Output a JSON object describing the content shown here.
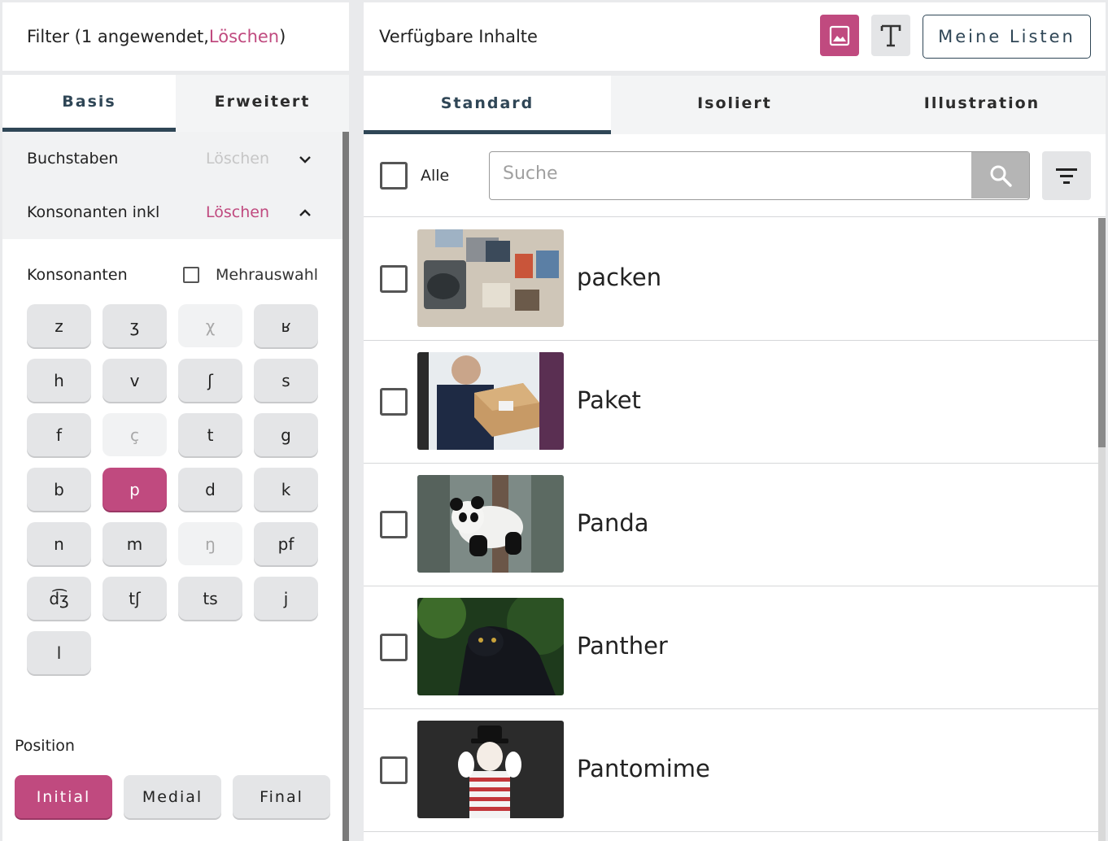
{
  "filter": {
    "prefix": "Filter (1 angewendet, ",
    "clear": "Löschen",
    "suffix": ")"
  },
  "left_tabs": [
    {
      "label": "Basis",
      "active": true
    },
    {
      "label": "Erweitert",
      "active": false
    }
  ],
  "accordions": [
    {
      "label": "Buchstaben",
      "clear": "Löschen",
      "clear_active": false,
      "expanded": false
    },
    {
      "label": "Konsonanten inkl",
      "clear": "Löschen",
      "clear_active": true,
      "expanded": true
    }
  ],
  "consonants": {
    "label": "Konsonanten",
    "multi_label": "Mehrauswahl",
    "multi_checked": false,
    "items": [
      {
        "label": "z",
        "state": "normal"
      },
      {
        "label": "ʒ",
        "state": "normal"
      },
      {
        "label": "χ",
        "state": "disabled"
      },
      {
        "label": "ʁ",
        "state": "normal"
      },
      {
        "label": "h",
        "state": "normal"
      },
      {
        "label": "v",
        "state": "normal"
      },
      {
        "label": "ʃ",
        "state": "normal"
      },
      {
        "label": "s",
        "state": "normal"
      },
      {
        "label": "f",
        "state": "normal"
      },
      {
        "label": "ç",
        "state": "disabled"
      },
      {
        "label": "t",
        "state": "normal"
      },
      {
        "label": "g",
        "state": "normal"
      },
      {
        "label": "b",
        "state": "normal"
      },
      {
        "label": "p",
        "state": "selected"
      },
      {
        "label": "d",
        "state": "normal"
      },
      {
        "label": "k",
        "state": "normal"
      },
      {
        "label": "n",
        "state": "normal"
      },
      {
        "label": "m",
        "state": "normal"
      },
      {
        "label": "ŋ",
        "state": "disabled"
      },
      {
        "label": "pf",
        "state": "normal"
      },
      {
        "label": "d͡ʒ",
        "state": "normal"
      },
      {
        "label": "tʃ",
        "state": "normal"
      },
      {
        "label": "ts",
        "state": "normal"
      },
      {
        "label": "j",
        "state": "normal"
      },
      {
        "label": "l",
        "state": "normal"
      }
    ]
  },
  "position": {
    "label": "Position",
    "options": [
      {
        "label": "Initial",
        "selected": true
      },
      {
        "label": "Medial",
        "selected": false
      },
      {
        "label": "Final",
        "selected": false
      }
    ]
  },
  "content": {
    "title": "Verfügbare Inhalte",
    "my_lists": "Meine Listen",
    "view_image_icon": "image-icon",
    "view_text_icon": "text-icon"
  },
  "right_tabs": [
    {
      "label": "Standard",
      "active": true
    },
    {
      "label": "Isoliert",
      "active": false
    },
    {
      "label": "Illustration",
      "active": false
    }
  ],
  "toolbar": {
    "all_label": "Alle",
    "search_placeholder": "Suche"
  },
  "items": [
    {
      "word": "packen",
      "image": "packing-photo"
    },
    {
      "word": "Paket",
      "image": "parcel-photo"
    },
    {
      "word": "Panda",
      "image": "panda-photo"
    },
    {
      "word": "Panther",
      "image": "panther-photo"
    },
    {
      "word": "Pantomime",
      "image": "mime-photo"
    }
  ],
  "colors": {
    "accent": "#c04a7f",
    "primary": "#2f4656"
  }
}
